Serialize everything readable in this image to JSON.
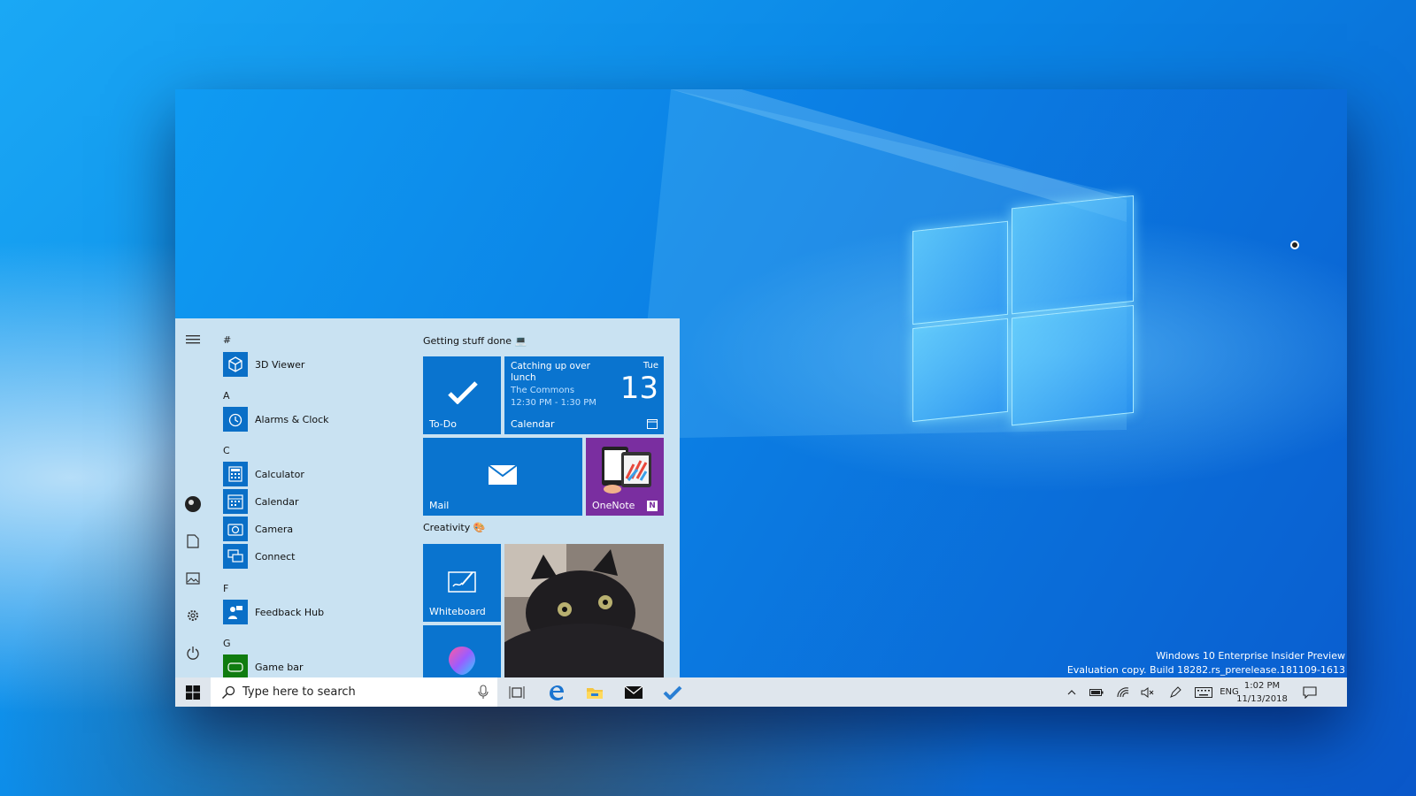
{
  "watermark": {
    "line1": "Windows 10 Enterprise Insider Preview",
    "line2": "Evaluation copy. Build 18282.rs_prerelease.181109-1613"
  },
  "start_menu": {
    "apps": [
      {
        "letter": "#",
        "items": [
          "3D Viewer"
        ]
      },
      {
        "letter": "A",
        "items": [
          "Alarms & Clock"
        ]
      },
      {
        "letter": "C",
        "items": [
          "Calculator",
          "Calendar",
          "Camera",
          "Connect"
        ]
      },
      {
        "letter": "F",
        "items": [
          "Feedback Hub"
        ]
      },
      {
        "letter": "G",
        "items": [
          "Game bar"
        ]
      }
    ],
    "group1": {
      "title": "Getting stuff done 💻",
      "todo_label": "To-Do",
      "calendar": {
        "event": "Catching up over lunch",
        "location": "The Commons",
        "time": "12:30 PM - 1:30 PM",
        "day": "Tue",
        "date": "13",
        "label": "Calendar"
      },
      "mail_label": "Mail",
      "onenote_label": "OneNote"
    },
    "group2": {
      "title": "Creativity 🎨",
      "whiteboard_label": "Whiteboard"
    }
  },
  "taskbar": {
    "search_placeholder": "Type here to search",
    "language": "ENG",
    "time": "1:02 PM",
    "date": "11/13/2018"
  },
  "colors": {
    "accent": "#0a74cf",
    "onenote": "#7a2ea0",
    "start_bg": "#c9e2f2",
    "taskbar_bg": "#dfe6ed"
  }
}
